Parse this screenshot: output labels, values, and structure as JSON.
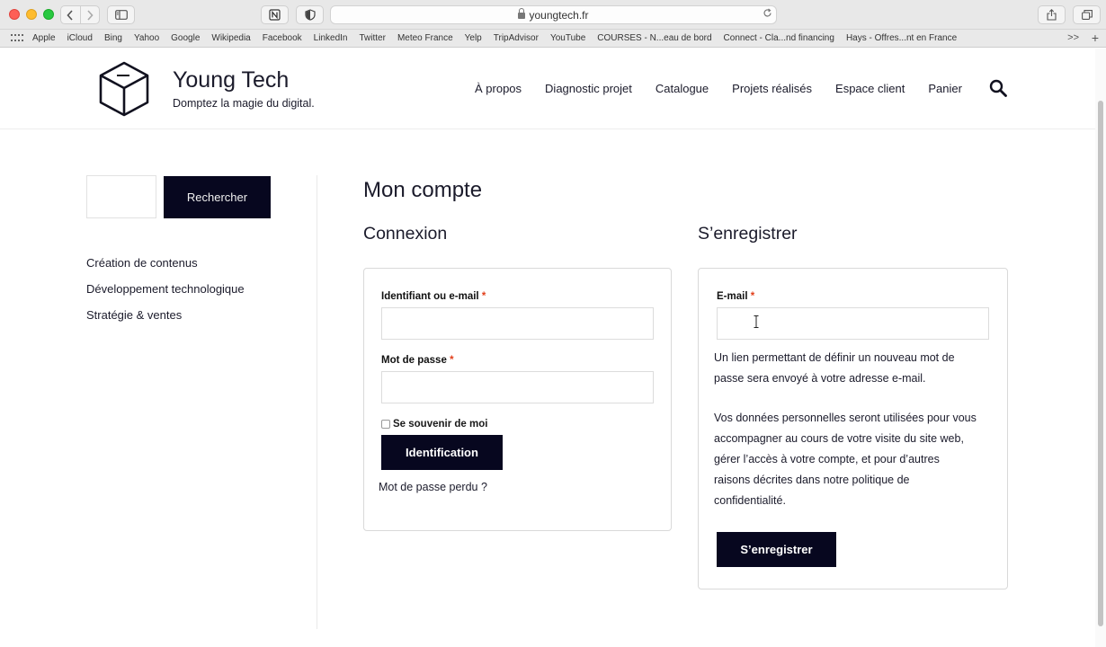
{
  "browser": {
    "url": "youngtech.fr",
    "bookmarks": [
      "Apple",
      "iCloud",
      "Bing",
      "Yahoo",
      "Google",
      "Wikipedia",
      "Facebook",
      "LinkedIn",
      "Twitter",
      "Meteo France",
      "Yelp",
      "TripAdvisor",
      "YouTube",
      "COURSES - N...eau de bord",
      "Connect - Cla...nd financing",
      "Hays - Offres...nt en France"
    ],
    "more_glyph": ">>",
    "add_glyph": "+"
  },
  "site": {
    "title": "Young Tech",
    "tagline": "Domptez la magie du digital.",
    "nav": [
      "À propos",
      "Diagnostic projet",
      "Catalogue",
      "Projets réalisés",
      "Espace client",
      "Panier"
    ]
  },
  "sidebar": {
    "search_button": "Rechercher",
    "categories": [
      "Création de contenus",
      "Développement technologique",
      "Stratégie & ventes"
    ]
  },
  "main": {
    "page_title": "Mon compte",
    "login": {
      "title": "Connexion",
      "username_label": "Identifiant ou e-mail",
      "password_label": "Mot de passe",
      "required_mark": "*",
      "remember_label": "Se souvenir de moi",
      "submit": "Identification",
      "lost_password": "Mot de passe perdu ?"
    },
    "register": {
      "title": "S’enregistrer",
      "email_label": "E-mail",
      "required_mark": "*",
      "info_lines": [
        "Un lien permettant de définir un nouveau mot de",
        "passe sera envoyé à votre adresse e-mail."
      ],
      "privacy_lines": [
        "Vos données personnelles seront utilisées pour vous",
        "accompagner au cours de votre visite du site web,",
        "gérer l’accès à votre compte, et pour d’autres",
        "raisons décrites dans notre politique de",
        "confidentialité."
      ],
      "submit": "S’enregistrer"
    }
  },
  "colors": {
    "accent_dark": "#07071f",
    "required": "#e2401c"
  }
}
